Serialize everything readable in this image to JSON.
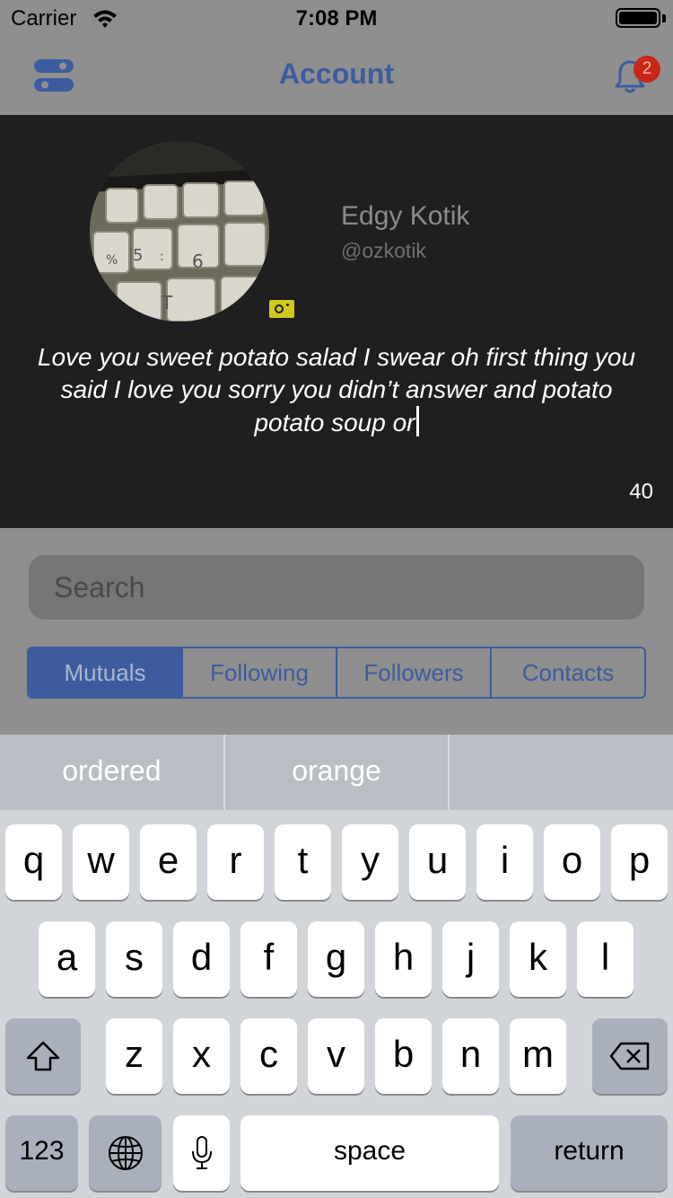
{
  "status_bar": {
    "carrier": "Carrier",
    "time": "7:08 PM"
  },
  "nav": {
    "title": "Account",
    "notification_count": "2"
  },
  "profile": {
    "name": "Edgy Kotik",
    "handle": "@ozkotik",
    "bio": "Love you sweet potato salad I swear oh first thing you said I love you sorry you didn’t answer and potato potato soup or",
    "char_count": "40"
  },
  "search": {
    "placeholder": "Search"
  },
  "tabs": [
    {
      "label": "Mutuals",
      "active": true
    },
    {
      "label": "Following",
      "active": false
    },
    {
      "label": "Followers",
      "active": false
    },
    {
      "label": "Contacts",
      "active": false
    }
  ],
  "keyboard": {
    "suggestions": [
      "ordered",
      "orange",
      ""
    ],
    "row1": [
      "q",
      "w",
      "e",
      "r",
      "t",
      "y",
      "u",
      "i",
      "o",
      "p"
    ],
    "row2": [
      "a",
      "s",
      "d",
      "f",
      "g",
      "h",
      "j",
      "k",
      "l"
    ],
    "row3": [
      "z",
      "x",
      "c",
      "v",
      "b",
      "n",
      "m"
    ],
    "numbers_label": "123",
    "space_label": "space",
    "return_label": "return"
  },
  "colors": {
    "accent": "#3d5c9e",
    "badge": "#c7281a",
    "panel": "#1f1f1f"
  }
}
